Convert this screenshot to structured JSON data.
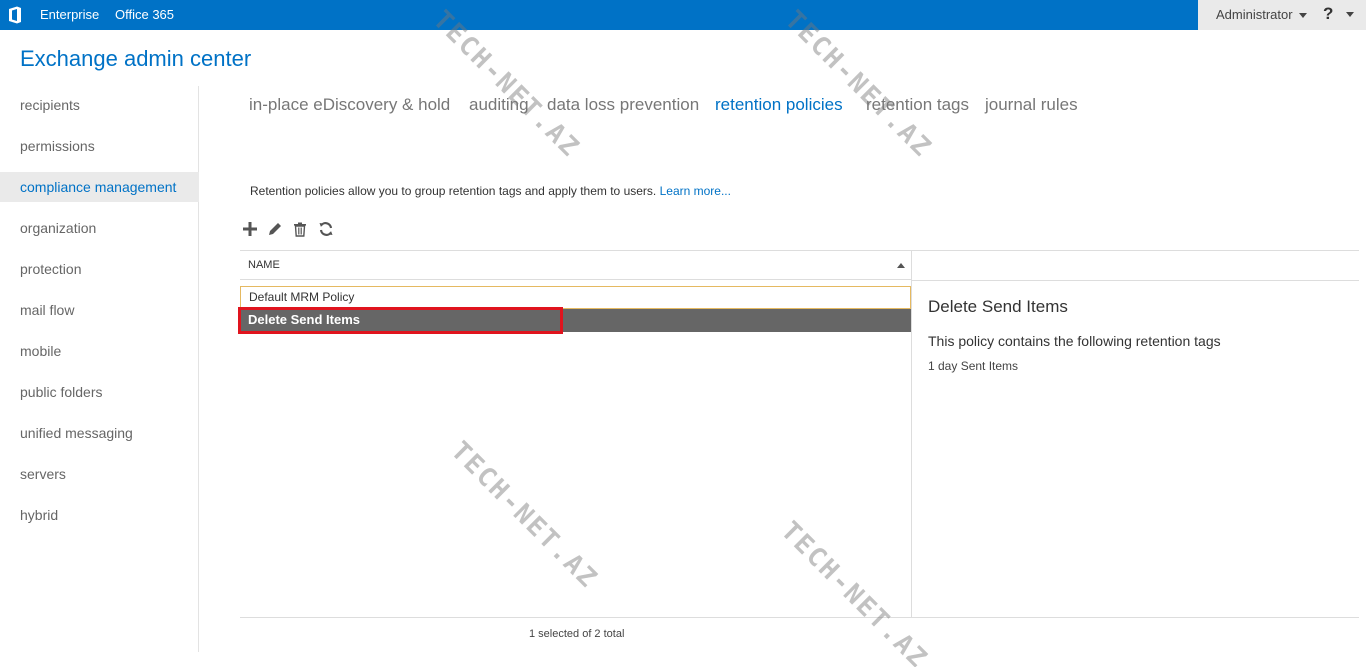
{
  "topbar": {
    "logo_icon": "office-logo-icon",
    "links": [
      "Enterprise",
      "Office 365"
    ],
    "user": "Administrator",
    "help": "?"
  },
  "app_title": "Exchange admin center",
  "nav": {
    "items": [
      {
        "label": "recipients"
      },
      {
        "label": "permissions"
      },
      {
        "label": "compliance management",
        "active": true
      },
      {
        "label": "organization"
      },
      {
        "label": "protection"
      },
      {
        "label": "mail flow"
      },
      {
        "label": "mobile"
      },
      {
        "label": "public folders"
      },
      {
        "label": "unified messaging"
      },
      {
        "label": "servers"
      },
      {
        "label": "hybrid"
      }
    ]
  },
  "tabs": [
    {
      "label": "in-place eDiscovery & hold"
    },
    {
      "label": "auditing"
    },
    {
      "label": "data loss prevention"
    },
    {
      "label": "retention policies",
      "active": true
    },
    {
      "label": "retention tags"
    },
    {
      "label": "journal rules"
    }
  ],
  "description": {
    "text": "Retention policies allow you to group retention tags and apply them to users.",
    "link": "Learn more..."
  },
  "toolbar": {
    "icons": [
      "add-icon",
      "edit-icon",
      "delete-icon",
      "refresh-icon"
    ]
  },
  "list": {
    "column": "NAME",
    "rows": [
      {
        "name": "Default MRM Policy"
      },
      {
        "name": "Delete Send Items",
        "selected": true
      }
    ]
  },
  "details": {
    "title": "Delete Send Items",
    "subtitle": "This policy contains the following retention tags",
    "tags": [
      "1 day Sent Items"
    ]
  },
  "status": "1 selected of 2 total",
  "watermark": "TECH-NET.AZ",
  "colors": {
    "accent": "#0072c6",
    "selected_row": "#666666",
    "highlight": "#e0141e"
  }
}
